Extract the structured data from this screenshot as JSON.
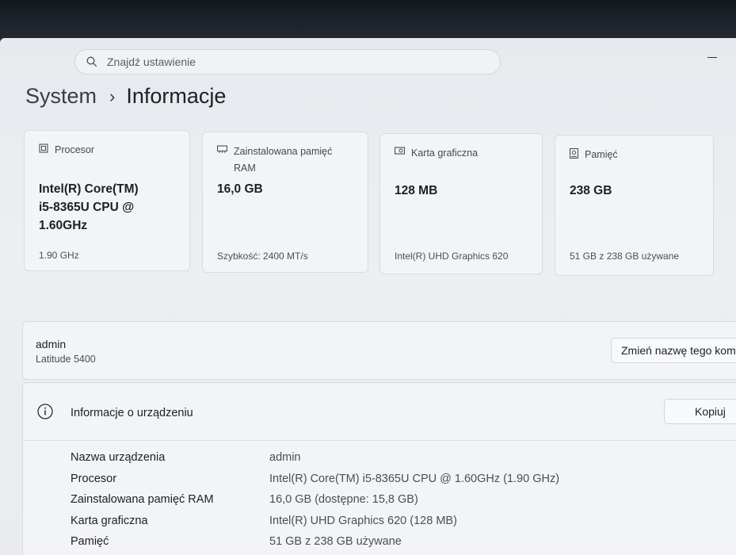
{
  "search": {
    "placeholder": "Znajdź ustawienie"
  },
  "breadcrumb": {
    "parent": "System",
    "separator": "›",
    "current": "Informacje"
  },
  "cards": {
    "processor": {
      "label": "Procesor",
      "value_lines": [
        "Intel(R) Core(TM)",
        "i5-8365U CPU @",
        "1.60GHz"
      ],
      "sub": "1.90 GHz"
    },
    "ram": {
      "label_lines": [
        "Zainstalowana pamięć",
        "RAM"
      ],
      "value": "16,0 GB",
      "sub": "Szybkość: 2400 MT/s"
    },
    "gpu": {
      "label": "Karta graficzna",
      "value": "128 MB",
      "sub": "Intel(R) UHD Graphics 620"
    },
    "storage": {
      "label": "Pamięć",
      "value": "238 GB",
      "sub": "51 GB z 238 GB używane"
    }
  },
  "device": {
    "name": "admin",
    "model": "Latitude 5400",
    "rename_label": "Zmień nazwę tego komputera"
  },
  "device_info": {
    "title": "Informacje o urządzeniu",
    "copy_label": "Kopiuj",
    "rows": [
      {
        "key": "Nazwa urządzenia",
        "value": "admin"
      },
      {
        "key": "Procesor",
        "value": "Intel(R) Core(TM) i5-8365U CPU @ 1.60GHz (1.90 GHz)"
      },
      {
        "key": "Zainstalowana pamięć RAM",
        "value": "16,0 GB (dostępne: 15,8 GB)"
      },
      {
        "key": "Karta graficzna",
        "value": "Intel(R) UHD Graphics 620 (128 MB)"
      },
      {
        "key": "Pamięć",
        "value": "51 GB z 238 GB używane"
      }
    ]
  },
  "icons": [
    "search-icon",
    "minimize-icon",
    "chevron-right-icon",
    "processor-icon",
    "ram-icon",
    "gpu-icon",
    "storage-icon",
    "info-icon"
  ]
}
